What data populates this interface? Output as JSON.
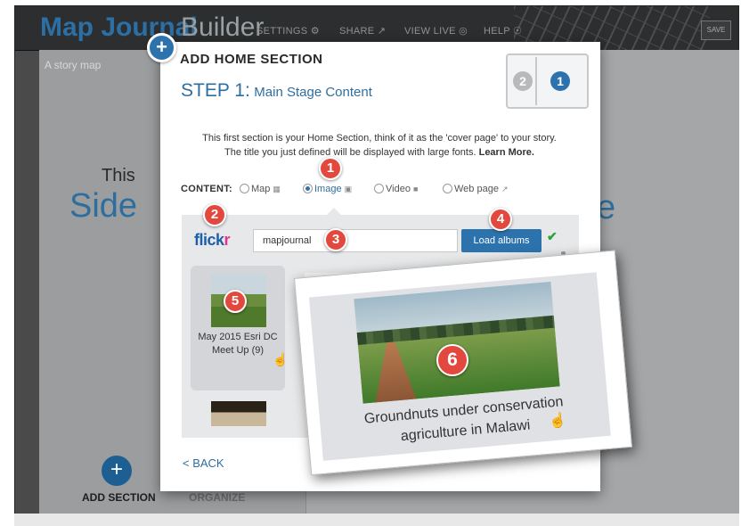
{
  "app": {
    "brand": "Map Journal",
    "brand_suffix": "Builder",
    "nav": [
      "SETTINGS ⚙",
      "SHARE ↗",
      "VIEW LIVE ◎",
      "HELP ☉"
    ],
    "save": "SAVE",
    "story_label": "A story map",
    "bg_text_small": "This",
    "bg_text_left": "Side",
    "bg_text_right": "e",
    "add_section": "ADD SECTION",
    "organize": "ORGANIZE"
  },
  "dialog": {
    "title": "ADD HOME SECTION",
    "step_label": "STEP 1:",
    "step_name": "Main Stage Content",
    "layout_num_left": "2",
    "layout_num_right": "1",
    "intro_line1": "This first section is your Home Section, think of it as the 'cover page' to your story.",
    "intro_line2": "The title you just defined will be displayed with large fonts.",
    "learn_more": "Learn More.",
    "content_label": "CONTENT:",
    "options": [
      {
        "label": "Map",
        "icon": "map-icon",
        "selected": false
      },
      {
        "label": "Image",
        "icon": "camera-icon",
        "selected": true
      },
      {
        "label": "Video",
        "icon": "video-icon",
        "selected": false
      },
      {
        "label": "Web page",
        "icon": "external-link-icon",
        "selected": false
      }
    ],
    "provider": {
      "part1": "flick",
      "part2": "r"
    },
    "username": "mapjournal",
    "load_button": "Load albums",
    "album_name": "May 2015 Esri DC Meet Up (9)",
    "back": "< BACK"
  },
  "callout": {
    "caption": "Groundnuts under conservation agriculture in Malawi"
  },
  "markers": [
    "1",
    "2",
    "3",
    "4",
    "5",
    "6"
  ],
  "colors": {
    "accent": "#2c73ad",
    "marker": "#e2483d",
    "brand": "#2b6fa5"
  }
}
